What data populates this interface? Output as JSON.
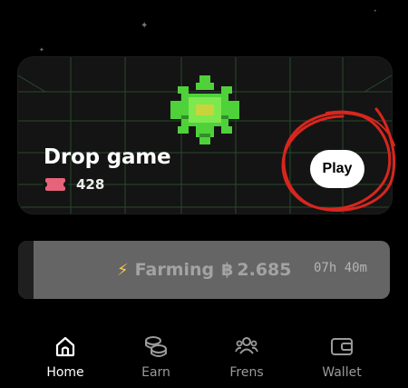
{
  "game_card": {
    "title": "Drop game",
    "ticket_icon": "ticket-icon",
    "ticket_count": "428",
    "play_label": "Play",
    "art_icon": "green-pixel-star",
    "grid_color": "#2c5230"
  },
  "farming": {
    "icon": "lightning-icon",
    "label": "Farming",
    "currency_symbol": "฿",
    "value": "2.685",
    "timer": "07h 40m"
  },
  "nav": {
    "active": "Home",
    "items": [
      {
        "label": "Home",
        "icon": "home-icon"
      },
      {
        "label": "Earn",
        "icon": "coins-icon"
      },
      {
        "label": "Frens",
        "icon": "friends-icon"
      },
      {
        "label": "Wallet",
        "icon": "wallet-icon"
      }
    ]
  },
  "colors": {
    "background": "#000000",
    "card": "#141414",
    "annotation_circle": "#d8261e",
    "farming_bar": "#656565",
    "bolt": "#f2c94c",
    "ticket": "#e6637a"
  }
}
